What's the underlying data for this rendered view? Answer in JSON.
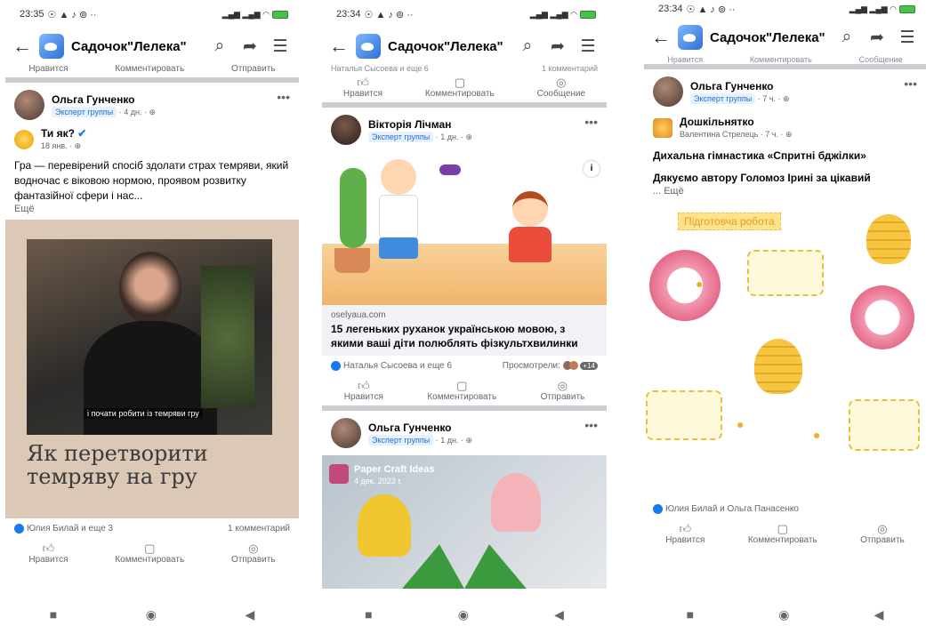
{
  "screens": [
    {
      "status": {
        "time": "23:35"
      },
      "appbar": {
        "title": "Садочок\"Лелека\""
      },
      "top_actions": [
        "Нравится",
        "Комментировать",
        "Отправить"
      ],
      "post": {
        "author": "Ольга Гунченко",
        "badge": "Эксперт группы",
        "time": "4 дн.",
        "shared": {
          "name": "Ти як?",
          "time": "18 янв."
        },
        "text": "Гра — перевірений спосіб здолати страх темряви, який водночас є віковою нормою, проявом розвитку фантазійної сфери і нас...",
        "more": "Ещё",
        "image_caption": "і почати робити із темряви гру",
        "overlay_title": "Як перетворити темряву на гру",
        "reactions": "Юлия Билай и еще 3",
        "comments": "1 комментарий"
      },
      "bottom_actions": [
        "Нравится",
        "Комментировать",
        "Отправить"
      ]
    },
    {
      "status": {
        "time": "23:34"
      },
      "appbar": {
        "title": "Садочок\"Лелека\""
      },
      "top_faint": "Наталья Сысоева и еще 6",
      "top_faint_right": "1 комментарий",
      "top_actions": [
        "Нравится",
        "Комментировать",
        "Сообщение"
      ],
      "post": {
        "author": "Вікторія Лічман",
        "badge": "Эксперт группы",
        "time": "1 дн.",
        "link_host": "oselyaua.com",
        "link_title": "15 легеньких руханок українською мовою, з якими ваші діти полюблять фізкультхвилинки",
        "reactions": "Наталья Сысоева и еще 6",
        "views": "Просмотрели:",
        "views_count": "+14"
      },
      "bottom_actions": [
        "Нравится",
        "Комментировать",
        "Отправить"
      ],
      "post2": {
        "author": "Ольга Гунченко",
        "badge": "Эксперт группы",
        "time": "1 дн.",
        "video_title": "Paper Craft Ideas",
        "video_sub": "4 дек. 2023 г."
      }
    },
    {
      "status": {
        "time": "23:34"
      },
      "appbar": {
        "title": "Садочок\"Лелека\""
      },
      "top_actions": [
        "Нравится",
        "Комментировать",
        "Сообщение"
      ],
      "post": {
        "author": "Ольга Гунченко",
        "badge": "Эксперт группы",
        "time": "7 ч.",
        "shared_page": "Дошкільнятко",
        "shared_author": "Валентина Стрелець",
        "shared_time": "7 ч.",
        "title": "Дихальна гімнастика «Спритні бджілки»",
        "text": "Дякуємо автору Голомоз Ірині за цікавий",
        "more": "... Ещё",
        "image_label": "Підготовча робота",
        "reactions": "Юлия Билай и Ольга Панасенко"
      },
      "bottom_actions": [
        "Нравится",
        "Комментировать",
        "Отправить"
      ]
    }
  ],
  "colors": {
    "accent": "#1877f2",
    "badge_bg": "#e7f0fd",
    "divider": "#c9ccd1"
  }
}
